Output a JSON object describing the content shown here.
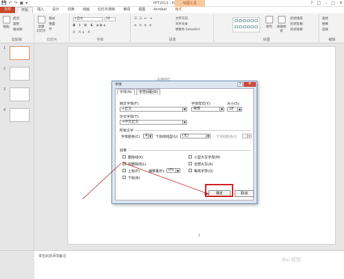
{
  "window": {
    "title": "PPT2013 - PowerPoint",
    "context_tab_group": "绘图工具",
    "controls": [
      "?",
      "□",
      "–",
      "□",
      "✕"
    ]
  },
  "qat": [
    "💾",
    "↶",
    "↷",
    "▣",
    "▾"
  ],
  "tabs": [
    {
      "label": "文件",
      "kind": "file"
    },
    {
      "label": "开始",
      "kind": "active"
    },
    {
      "label": "插入"
    },
    {
      "label": "设计"
    },
    {
      "label": "切换"
    },
    {
      "label": "动画"
    },
    {
      "label": "幻灯片放映"
    },
    {
      "label": "审阅"
    },
    {
      "label": "视图"
    },
    {
      "label": "Acrobat"
    },
    {
      "label": "格式",
      "kind": "format"
    }
  ],
  "ribbon": {
    "clipboard": {
      "label": "剪贴板",
      "paste": "粘贴",
      "cut": "剪切",
      "copy": "复制",
      "format_painter": "格式刷"
    },
    "slides": {
      "label": "幻灯片",
      "new_slide": "新建\n幻灯片",
      "layout": "版式",
      "reset": "重置",
      "section": "节"
    },
    "font": {
      "label": "字体",
      "font_name": "+正文",
      "font_size": "16"
    },
    "paragraph": {
      "label": "段落",
      "text_direction": "文字方向",
      "align_text": "对齐文本",
      "smartart": "转换为 SmartArt"
    },
    "drawing": {
      "label": "绘图",
      "arrange": "排列",
      "quick_styles": "快速样式",
      "shape_fill": "形状填充",
      "shape_outline": "形状轮廓",
      "shape_effects": "形状效果"
    },
    "editing": {
      "label": "编辑",
      "find": "查找",
      "replace": "替换",
      "select": "选择"
    }
  },
  "thumbnails": [
    "1",
    "2",
    "3",
    "4"
  ],
  "slide": {
    "ghost_text": "- 示例PPT",
    "page_number": "1"
  },
  "notes": {
    "placeholder": "单击此处添加备注"
  },
  "dialog": {
    "title": "字体",
    "help": "?",
    "close": "✕",
    "tabs": [
      "字体(N)",
      "字符间距(R)"
    ],
    "western_font_label": "西文字体(F):",
    "western_font_value": "+正文",
    "font_style_label": "字体样式(Y):",
    "font_style_value": "常规",
    "size_label": "大小(S):",
    "size_value": "18",
    "asian_font_label": "中文字体(T):",
    "asian_font_value": "+中文正文",
    "all_text_label": "所有文字",
    "font_color_label": "字体颜色(C)",
    "underline_style_label": "下划线线型(U)",
    "underline_style_value": "(无)",
    "underline_color_label": "下划线颜色(I)",
    "effects_label": "效果",
    "effects_left": [
      {
        "label": "删除线(K)",
        "checked": false
      },
      {
        "label": "双删除线(L)",
        "checked": true
      },
      {
        "label": "上标(P)",
        "checked": false
      },
      {
        "label": "下标(B)",
        "checked": false
      }
    ],
    "effects_right": [
      {
        "label": "小型大写字母(M)",
        "checked": false
      },
      {
        "label": "全部大写(A)",
        "checked": false
      },
      {
        "label": "等高字符(Q)",
        "checked": false
      }
    ],
    "offset_label": "偏移量(E):",
    "offset_value": "0%",
    "ok": "确定",
    "cancel": "取消"
  },
  "watermark": "Bai 经验"
}
